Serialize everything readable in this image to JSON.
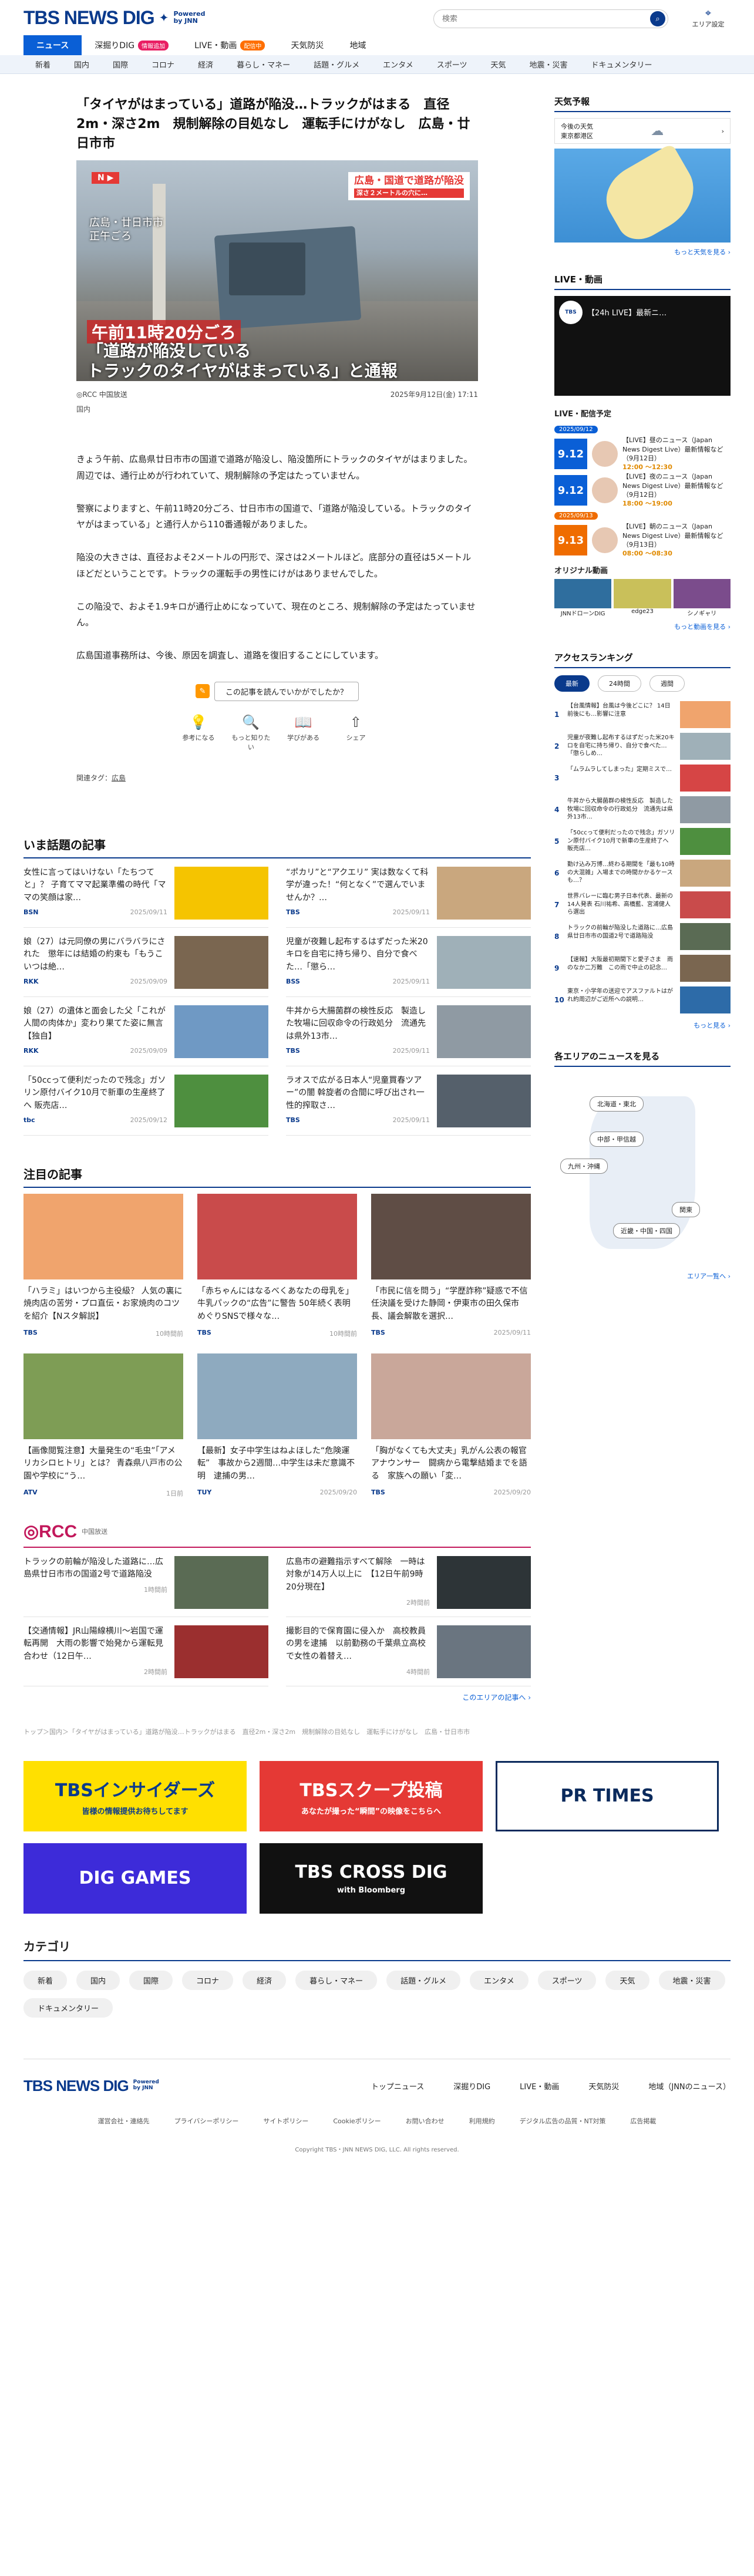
{
  "header": {
    "logo": "TBS NEWS DIG",
    "powered": "Powered",
    "by": "by JNN",
    "search_placeholder": "検索",
    "area_label": "エリア設定"
  },
  "mainnav": [
    {
      "label": "ニュース",
      "active": true
    },
    {
      "label": "深掘りDIG",
      "badge": "情報追加",
      "badge_color": "#e91e63"
    },
    {
      "label": "LIVE・動画",
      "badge": "配信中",
      "badge_color": "#ff6f00"
    },
    {
      "label": "天気防災"
    },
    {
      "label": "地域"
    }
  ],
  "subnav": [
    "新着",
    "国内",
    "国際",
    "コロナ",
    "経済",
    "暮らし・マネー",
    "話題・グルメ",
    "エンタメ",
    "スポーツ",
    "天気",
    "地震・災害",
    "ドキュメンタリー"
  ],
  "article": {
    "title": "「タイヤがはまっている」道路が陥没…トラックがはまる　直径2m・深さ2m　規制解除の目処なし　運転手にけがなし　広島・廿日市市",
    "hero": {
      "corner": "N ▶",
      "location": "広島・廿日市市\n正午ごろ",
      "tag": "広島・国道で道路が陥没",
      "tag_sub": "深さ２メートルの穴に…",
      "time": "午前11時20分ごろ",
      "caption": "「道路が陥没している\nトラックのタイヤがはまっている」と通報"
    },
    "source": "◎RCC 中国放送",
    "datetime": "2025年9月12日(金) 17:11",
    "category": "国内",
    "paragraphs": [
      "きょう午前、広島県廿日市市の国道で道路が陥没し、陥没箇所にトラックのタイヤがはまりました。周辺では、通行止めが行われていて、規制解除の予定はたっていません。",
      "警察によりますと、午前11時20分ごろ、廿日市市の国道で、「道路が陥没している。トラックのタイヤがはまっている」と通行人から110番通報がありました。",
      "陥没の大きさは、直径およそ2メートルの円形で、深さは2メートルほど。底部分の直径は5メートルほどだということです。トラックの運転手の男性にけがはありませんでした。",
      "この陥没で、およそ1.9キロが通行止めになっていて、現在のところ、規制解除の予定はたっていません。",
      "広島国道事務所は、今後、原因を調査し、道路を復旧することにしています。"
    ],
    "feedback_q": "この記事を読んでいかがでしたか？",
    "feedback_btns": [
      {
        "icon": "💡",
        "label": "参考になる"
      },
      {
        "icon": "🔍",
        "label": "もっと知りたい"
      },
      {
        "icon": "📖",
        "label": "学びがある"
      },
      {
        "icon": "⇧",
        "label": "シェア"
      }
    ],
    "related_label": "関連タグ：",
    "related_tag": "広島"
  },
  "topics": {
    "title": "いま話題の記事",
    "items": [
      {
        "text": "女性に言ってはいけない「たちつてと」？ 子育てママ起業準備の時代「ママの笑顔は家…",
        "src": "BSN",
        "date": "2025/09/11",
        "color": "#f5c400"
      },
      {
        "text": "“ポカリ”と“アクエリ” 実は数なくて科学が違った！“何となく”で選んでいませんか？…",
        "src": "TBS",
        "date": "2025/09/11",
        "color": "#c9a77e"
      },
      {
        "text": "娘（27）は元同僚の男にバラバラにされた　懲年には結婚の約束も「もうこいつは絶…",
        "src": "RKK",
        "date": "2025/09/09",
        "color": "#7a6650"
      },
      {
        "text": "児童が夜難し起布するはずだった米20キロを自宅に持ち帰り、自分で食べた…「懲ら…",
        "src": "BSS",
        "date": "2025/09/11",
        "color": "#9fb0b8"
      },
      {
        "text": "娘（27）の遺体と面会した父「これが人間の肉体か」変わり果てた姿に無言【独自】",
        "src": "RKK",
        "date": "2025/09/09",
        "color": "#6f99c4"
      },
      {
        "text": "牛丼から大腸菌群の検性反応　製造した牧場に回収命令の行政処分　流通先は県外13市…",
        "src": "TBS",
        "date": "2025/09/11",
        "color": "#8f9aa3"
      },
      {
        "text": "「50ccって便利だったので残念」ガソリン原付バイク10月で新車の生産終了へ 販売店…",
        "src": "tbc",
        "date": "2025/09/12",
        "color": "#4e8f3f"
      },
      {
        "text": "ラオスで広がる日本人“児童買春ツアー”の闇 斡旋者の合間に呼び出され一性的搾取さ…",
        "src": "TBS",
        "date": "2025/09/11",
        "color": "#55606b"
      }
    ]
  },
  "featured": {
    "title": "注目の記事",
    "items": [
      {
        "text": "「ハラミ」はいつから主役級？ 人気の裏に焼肉店の苦労・プロ直伝・お家焼肉のコツを紹介【Nスタ解説】",
        "src": "TBS",
        "date": "10時間前",
        "color": "#f0a46d"
      },
      {
        "text": "「赤ちゃんにはなるべくあなたの母乳を」牛乳パックの“広告”に警告 50年続く表明めぐりSNSで様々な…",
        "src": "TBS",
        "date": "10時間前",
        "color": "#c94b4b"
      },
      {
        "text": "「市民に信を問う」“学歴詐称”疑惑で不信任決議を受けた静岡・伊東市の田久保市長、議会解散を選択…",
        "src": "TBS",
        "date": "2025/09/11",
        "color": "#5f4d45"
      },
      {
        "text": "【画像閲覧注意】大量発生の“毛虫”「アメリカシロヒトリ」とは？ 青森県八戸市の公園や学校に“う…",
        "src": "ATV",
        "date": "1日前",
        "color": "#7e9d55"
      },
      {
        "text": "【最新】女子中学生はねよほした“危険運転”　事故から2週間…中学生は未だ意識不明　逮捕の男…",
        "src": "TUY",
        "date": "2025/09/20",
        "color": "#8eaabf"
      },
      {
        "text": "「胸がなくても大丈夫」乳がん公表の報官アナウンサー　闘病から電撃結婚までを語る　家族への願い「変…",
        "src": "TBS",
        "date": "2025/09/20",
        "color": "#c9a79a"
      }
    ]
  },
  "rcc": {
    "logo": "◎RCC",
    "name": "中国放送",
    "more": "このエリアの記事へ ›",
    "items": [
      {
        "text": "トラックの前輪が陥没した道路に…広島県廿日市市の国道2号で道路陥没",
        "date": "1時間前",
        "color": "#5a6b54"
      },
      {
        "text": "広島市の避難指示すべて解除　一時は対象が14万人以上に　【12日午前9時20分現在】",
        "date": "2時間前",
        "color": "#2d3437"
      },
      {
        "text": "【交通情報】JR山陽線横川〜岩国で運転再開　大雨の影響で始発から運転見合わせ（12日午…",
        "date": "2時間前",
        "color": "#9b2f2f"
      },
      {
        "text": "撮影目的で保育園に侵入か　高校教員の男を逮捕　以前勤務の千葉県立高校で女性の着替え…",
        "date": "4時間前",
        "color": "#6a7580"
      }
    ]
  },
  "breadcrumb": "トップ＞国内＞「タイヤがはまっている」道路が陥没…トラックがはまる　直径2m・深さ2m　規制解除の目処なし　運転手にけがなし　広島・廿日市市",
  "banners": [
    {
      "text": "TBSインサイダーズ",
      "sub": "皆様の情報提供お待ちしてます",
      "bg": "#ffe000",
      "fg": "#0a3a8c"
    },
    {
      "text": "TBSスクープ投稿",
      "sub": "あなたが撮った“瞬間”の映像をこちらへ",
      "bg": "#e53935",
      "fg": "#fff"
    },
    {
      "text": "PR TIMES",
      "sub": "",
      "bg": "#fff",
      "fg": "#0a2a5c"
    },
    {
      "text": "DIG GAMES",
      "sub": "",
      "bg": "#3d2bd9",
      "fg": "#fff"
    },
    {
      "text": "TBS CROSS DIG",
      "sub": "with Bloomberg",
      "bg": "#111",
      "fg": "#fff"
    }
  ],
  "categories": {
    "title": "カテゴリ",
    "items": [
      "新着",
      "国内",
      "国際",
      "コロナ",
      "経済",
      "暮らし・マネー",
      "話題・グルメ",
      "エンタメ",
      "スポーツ",
      "天気",
      "地震・災害",
      "ドキュメンタリー"
    ]
  },
  "footer": {
    "links": [
      "トップニュース",
      "深掘りDIG",
      "LIVE・動画",
      "天気防災",
      "地域（JNNのニュース）"
    ],
    "sublinks": [
      "運営会社・連絡先",
      "プライバシーポリシー",
      "サイトポリシー",
      "Cookieポリシー",
      "お問い合わせ",
      "利用規約",
      "デジタル広告の品質・NT対策",
      "広告掲載"
    ],
    "copyright": "Copyright TBS・JNN NEWS DIG, LLC. All rights reserved."
  },
  "side": {
    "weather_title": "天気予報",
    "weather_loc": "今後の天気\n東京都港区",
    "weather_more": "もっと天気を見る ›",
    "live_title": "LIVE・動画",
    "live_video": "【24h LIVE】最新ニ…",
    "sched_title": "LIVE・配信予定",
    "schedule": [
      {
        "day": "2025/09/12",
        "color": "#0a5fd6",
        "date": "9.12",
        "title": "【LIVE】昼のニュース（Japan News Digest Live）最新情報など（9月12日）",
        "time": "12:00 〜12:30"
      },
      {
        "day": "",
        "color": "#0a5fd6",
        "date": "9.12",
        "title": "【LIVE】夜のニュース（Japan News Digest Live）最新情報など（9月12日）",
        "time": "18:00 〜19:00"
      },
      {
        "day": "2025/09/13",
        "color": "#ef6c00",
        "date": "9.13",
        "title": "【LIVE】朝のニュース（Japan News Digest Live）最新情報など（9月13日）",
        "time": "08:00 〜08:30"
      }
    ],
    "orig_title": "オリジナル動画",
    "orig": [
      "JNNドローンDIG",
      "edge23",
      "シノギャリ"
    ],
    "orig_more": "もっと動画を見る ›",
    "rank_title": "アクセスランキング",
    "rank_tabs": [
      "最新",
      "24時間",
      "週間"
    ],
    "ranking": [
      "【台風情報】台風は今後どこに？ 14日前後にも…影響に注意",
      "児童が夜難し起布するはずだった米20キロを自宅に持ち帰り、自分で食べた…「懲らしめ…",
      "「ムラムラしてしまった」定期ミスで…",
      "牛丼から大腸菌群の検性反応　製造した牧場に回収命令の行政処分　流通先は県外13市…",
      "「50ccって便利だったので残念」ガソリン原付バイク10月で新車の生産終了へ 販売店…",
      "勤け込み万博…終わる期間を「最も10時の大混雑」入場までの時間かかるケースも…？",
      "世界バレーに臨む男子日本代表、最新の14人発表 石川祐希、高橋藍、宮浦健人ら選出",
      "トラックの前輪が陥没した道路に…広島県廿日市市の国道2号で道路陥没",
      "【速報】大阪最初期間下と愛子さま　雨のなか二万難　この雨で中止の記念…",
      "東京・小学年の送迎でアスファルトはがれ約周辺がご近所への説明…"
    ],
    "rank_more": "もっと見る ›",
    "area_title": "各エリアのニュースを見る",
    "area_btns": [
      "北海道・東北",
      "中部・甲信越",
      "九州・沖縄",
      "関東",
      "近畿・中国・四国"
    ],
    "area_more": "エリア一覧へ ›"
  }
}
